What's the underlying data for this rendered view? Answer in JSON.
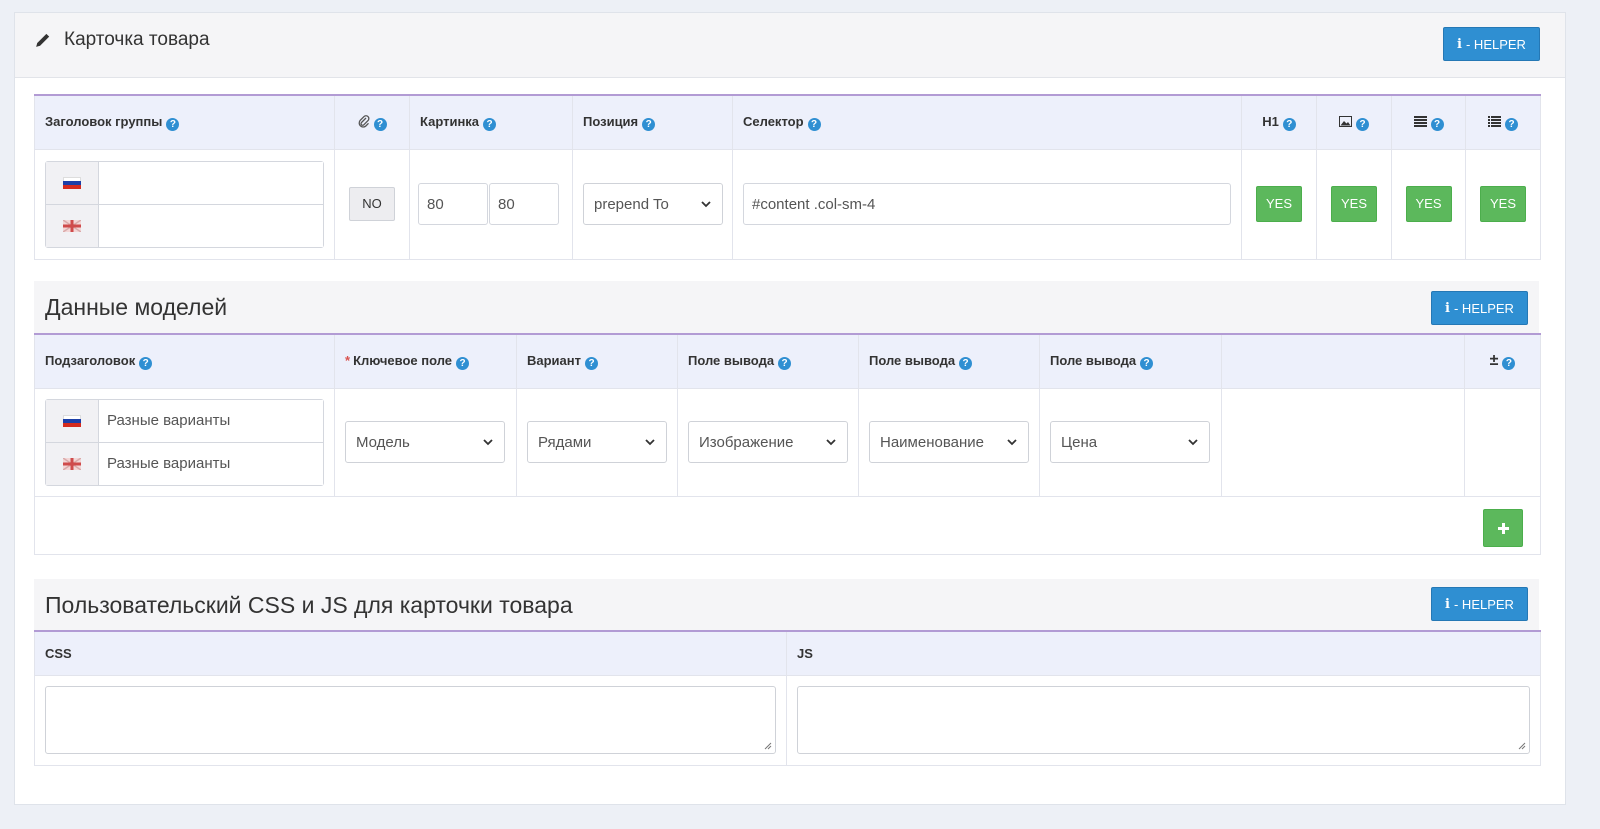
{
  "panel": {
    "title": "Карточка товара",
    "helper_label": "- HELPER"
  },
  "group_table": {
    "headers": {
      "title": "Заголовок группы",
      "image": "Картинка",
      "position": "Позиция",
      "selector": "Селектор",
      "h1": "H1"
    },
    "row": {
      "title_ru": "",
      "title_en": "",
      "link_toggle": "NO",
      "image_width": "80",
      "image_height": "80",
      "position": "prepend To",
      "selector": "#content .col-sm-4",
      "h1": "YES",
      "image_toggle": "YES",
      "desc_toggle": "YES",
      "list_toggle": "YES"
    }
  },
  "models": {
    "title": "Данные моделей",
    "helper_label": "- HELPER",
    "headers": {
      "subtitle": "Подзаголовок",
      "key_field": "Ключевое поле",
      "variant": "Вариант",
      "output1": "Поле вывода",
      "output2": "Поле вывода",
      "output3": "Поле вывода",
      "plusminus": "±"
    },
    "row": {
      "subtitle_ru": "Разные варианты",
      "subtitle_en": "Разные варианты",
      "key_field": "Модель",
      "variant": "Рядами",
      "output1": "Изображение",
      "output2": "Наименование",
      "output3": "Цена"
    }
  },
  "custom": {
    "title": "Пользовательский CSS и JS для карточки товара",
    "helper_label": "- HELPER",
    "css_label": "CSS",
    "js_label": "JS",
    "css_value": "",
    "js_value": ""
  },
  "colors": {
    "primary": "#2f8fd2",
    "success": "#5cb85c",
    "accent_border": "#b29bd4"
  }
}
